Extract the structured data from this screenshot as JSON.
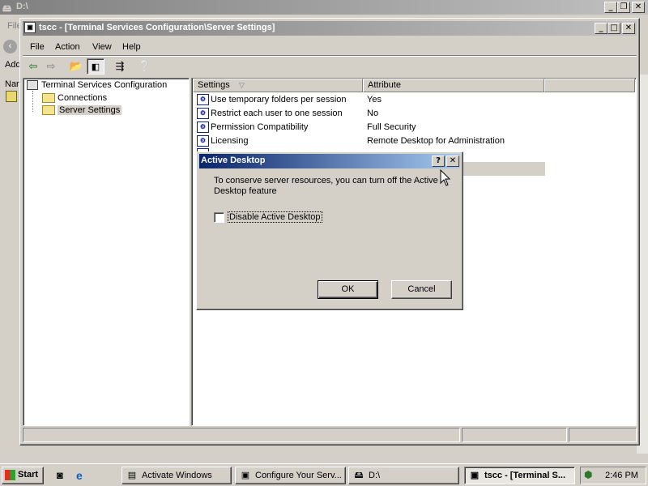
{
  "back_window": {
    "title": "D:\\",
    "menu_partial": "File",
    "addr_partial": "Add",
    "col_partial": "Nar"
  },
  "window": {
    "title": "tscc - [Terminal Services Configuration\\Server Settings]"
  },
  "menu": [
    "File",
    "Action",
    "View",
    "Help"
  ],
  "tree": {
    "root": "Terminal Services Configuration",
    "children": [
      "Connections",
      "Server Settings"
    ]
  },
  "list": {
    "headers": [
      "Settings",
      "Attribute"
    ],
    "rows": [
      {
        "setting": "Use temporary folders per session",
        "attribute": "Yes"
      },
      {
        "setting": "Restrict each user to one session",
        "attribute": "No"
      },
      {
        "setting": "Permission Compatibility",
        "attribute": "Full Security"
      },
      {
        "setting": "Licensing",
        "attribute": "Remote Desktop for Administration"
      }
    ]
  },
  "dialog": {
    "title": "Active Desktop",
    "message": "To conserve server resources, you can turn off the Active Desktop feature",
    "checkbox_label": "Disable Active Desktop",
    "checkbox_checked": false,
    "ok": "OK",
    "cancel": "Cancel"
  },
  "taskbar": {
    "start": "Start",
    "tasks": [
      "Activate Windows",
      "Configure Your Serv...",
      "D:\\",
      "tscc - [Terminal S..."
    ],
    "clock": "2:46 PM"
  }
}
